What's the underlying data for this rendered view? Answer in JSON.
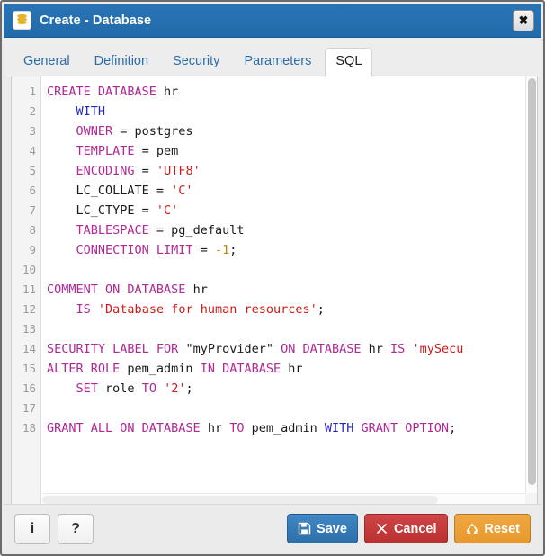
{
  "window": {
    "title": "Create - Database",
    "icon": "database-icon",
    "close_label": "✖"
  },
  "tabs": [
    {
      "label": "General",
      "name": "tab-general",
      "active": false
    },
    {
      "label": "Definition",
      "name": "tab-definition",
      "active": false
    },
    {
      "label": "Security",
      "name": "tab-security",
      "active": false
    },
    {
      "label": "Parameters",
      "name": "tab-parameters",
      "active": false
    },
    {
      "label": "SQL",
      "name": "tab-sql",
      "active": true
    }
  ],
  "editor": {
    "line_numbers": [
      "1",
      "2",
      "3",
      "4",
      "5",
      "6",
      "7",
      "8",
      "9",
      "10",
      "11",
      "12",
      "13",
      "14",
      "15",
      "16",
      "17",
      "18"
    ],
    "lines": [
      {
        "n": "1",
        "tokens": [
          {
            "t": "CREATE DATABASE ",
            "c": "kw"
          },
          {
            "t": "hr",
            "c": "pln"
          }
        ]
      },
      {
        "n": "2",
        "tokens": [
          {
            "t": "    ",
            "c": "pln"
          },
          {
            "t": "WITH",
            "c": "kw2"
          }
        ]
      },
      {
        "n": "3",
        "tokens": [
          {
            "t": "    ",
            "c": "pln"
          },
          {
            "t": "OWNER",
            "c": "kw"
          },
          {
            "t": " = postgres",
            "c": "pln"
          }
        ]
      },
      {
        "n": "4",
        "tokens": [
          {
            "t": "    ",
            "c": "pln"
          },
          {
            "t": "TEMPLATE",
            "c": "kw"
          },
          {
            "t": " = pem",
            "c": "pln"
          }
        ]
      },
      {
        "n": "5",
        "tokens": [
          {
            "t": "    ",
            "c": "pln"
          },
          {
            "t": "ENCODING",
            "c": "kw"
          },
          {
            "t": " = ",
            "c": "pln"
          },
          {
            "t": "'UTF8'",
            "c": "str"
          }
        ]
      },
      {
        "n": "6",
        "tokens": [
          {
            "t": "    LC_COLLATE = ",
            "c": "pln"
          },
          {
            "t": "'C'",
            "c": "str"
          }
        ]
      },
      {
        "n": "7",
        "tokens": [
          {
            "t": "    LC_CTYPE = ",
            "c": "pln"
          },
          {
            "t": "'C'",
            "c": "str"
          }
        ]
      },
      {
        "n": "8",
        "tokens": [
          {
            "t": "    ",
            "c": "pln"
          },
          {
            "t": "TABLESPACE",
            "c": "kw"
          },
          {
            "t": " = pg_default",
            "c": "pln"
          }
        ]
      },
      {
        "n": "9",
        "tokens": [
          {
            "t": "    ",
            "c": "pln"
          },
          {
            "t": "CONNECTION LIMIT",
            "c": "kw"
          },
          {
            "t": " = ",
            "c": "pln"
          },
          {
            "t": "-1",
            "c": "num"
          },
          {
            "t": ";",
            "c": "pln"
          }
        ]
      },
      {
        "n": "10",
        "tokens": [
          {
            "t": "",
            "c": "pln"
          }
        ]
      },
      {
        "n": "11",
        "tokens": [
          {
            "t": "COMMENT ON DATABASE ",
            "c": "kw"
          },
          {
            "t": "hr",
            "c": "pln"
          }
        ]
      },
      {
        "n": "12",
        "tokens": [
          {
            "t": "    ",
            "c": "pln"
          },
          {
            "t": "IS",
            "c": "kw"
          },
          {
            "t": " ",
            "c": "pln"
          },
          {
            "t": "'Database for human resources'",
            "c": "str"
          },
          {
            "t": ";",
            "c": "pln"
          }
        ]
      },
      {
        "n": "13",
        "tokens": [
          {
            "t": "",
            "c": "pln"
          }
        ]
      },
      {
        "n": "14",
        "tokens": [
          {
            "t": "SECURITY LABEL FOR",
            "c": "kw"
          },
          {
            "t": " \"myProvider\" ",
            "c": "pln"
          },
          {
            "t": "ON DATABASE",
            "c": "kw"
          },
          {
            "t": " hr ",
            "c": "pln"
          },
          {
            "t": "IS",
            "c": "kw"
          },
          {
            "t": " ",
            "c": "pln"
          },
          {
            "t": "'mySecu",
            "c": "str"
          }
        ]
      },
      {
        "n": "15",
        "tokens": [
          {
            "t": "ALTER ROLE",
            "c": "kw"
          },
          {
            "t": " pem_admin ",
            "c": "pln"
          },
          {
            "t": "IN DATABASE",
            "c": "kw"
          },
          {
            "t": " hr",
            "c": "pln"
          }
        ]
      },
      {
        "n": "16",
        "tokens": [
          {
            "t": "    ",
            "c": "pln"
          },
          {
            "t": "SET",
            "c": "kw"
          },
          {
            "t": " role ",
            "c": "pln"
          },
          {
            "t": "TO",
            "c": "kw"
          },
          {
            "t": " ",
            "c": "pln"
          },
          {
            "t": "'2'",
            "c": "str"
          },
          {
            "t": ";",
            "c": "pln"
          }
        ]
      },
      {
        "n": "17",
        "tokens": [
          {
            "t": "",
            "c": "pln"
          }
        ]
      },
      {
        "n": "18",
        "tokens": [
          {
            "t": "GRANT ALL ON DATABASE",
            "c": "kw"
          },
          {
            "t": " hr ",
            "c": "pln"
          },
          {
            "t": "TO",
            "c": "kw"
          },
          {
            "t": " pem_admin ",
            "c": "pln"
          },
          {
            "t": "WITH",
            "c": "kw2"
          },
          {
            "t": " ",
            "c": "pln"
          },
          {
            "t": "GRANT OPTION",
            "c": "kw"
          },
          {
            "t": ";",
            "c": "pln"
          }
        ]
      }
    ]
  },
  "footer": {
    "info_label": "i",
    "help_label": "?",
    "save_label": "Save",
    "cancel_label": "Cancel",
    "reset_label": "Reset"
  },
  "colors": {
    "titlebar": "#2a74b5",
    "tab_link": "#2b6ca8",
    "keyword": "#b02894",
    "keyword_alt": "#2727c4",
    "string": "#d01a1a",
    "number": "#b8860b",
    "save": "#2e6fa8",
    "cancel": "#bb3131",
    "reset": "#e7992c"
  }
}
